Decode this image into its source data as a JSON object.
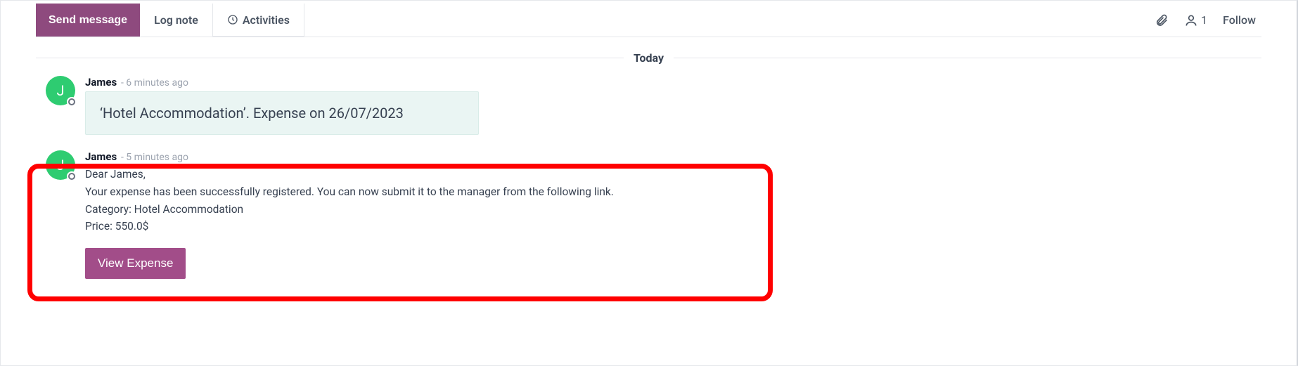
{
  "toolbar": {
    "send_label": "Send message",
    "log_note_label": "Log note",
    "activities_label": "Activities",
    "follower_count": "1",
    "follow_label": "Follow"
  },
  "separator": {
    "label": "Today"
  },
  "messages": [
    {
      "author": "James",
      "avatar_initial": "J",
      "time": "- 6 minutes ago",
      "note": "‘Hotel Accommodation’. Expense on 26/07/2023"
    },
    {
      "author": "James",
      "avatar_initial": "J",
      "time": "- 5 minutes ago",
      "lines": {
        "greeting": "Dear James,",
        "l1": "Your expense has been successfully registered. You can now submit it to the manager from the following link.",
        "l2": "Category: Hotel Accommodation",
        "l3": "Price: 550.0$"
      },
      "action_label": "View Expense"
    }
  ]
}
